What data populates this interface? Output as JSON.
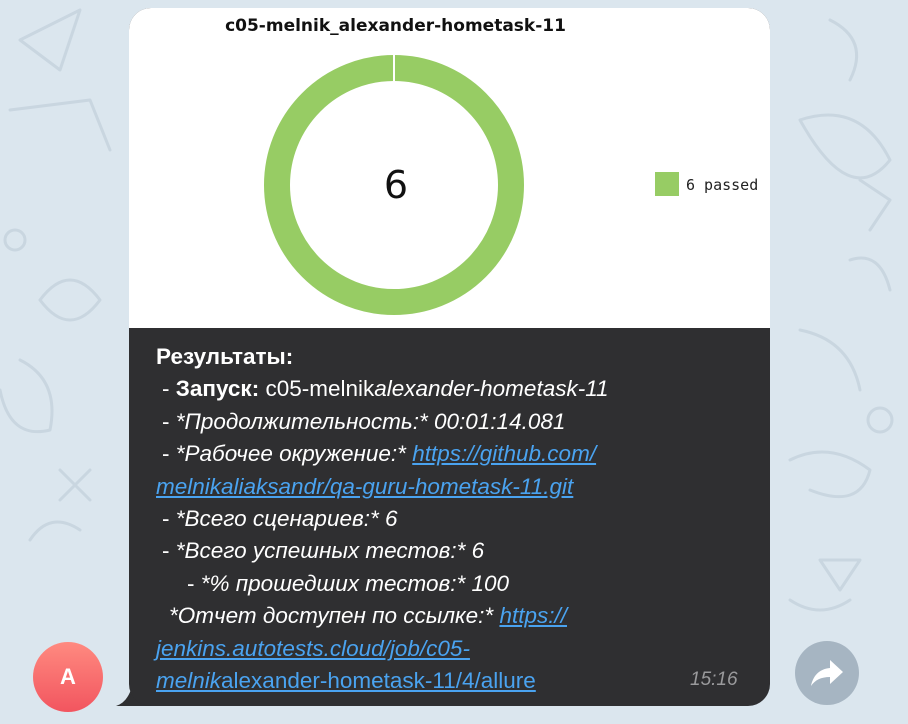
{
  "avatar": {
    "initial": "A",
    "color": "#f2555f"
  },
  "chart": {
    "title": "c05-melnik_alexander-hometask-11",
    "center_value": "6",
    "legend_label": "6 passed",
    "colors": {
      "passed": "#97cc64"
    }
  },
  "chart_data": {
    "type": "pie",
    "donut": true,
    "title": "c05-melnik_alexander-hometask-11",
    "categories": [
      "passed"
    ],
    "values": [
      6
    ],
    "legend": [
      "6 passed"
    ],
    "legend_position": "right"
  },
  "message": {
    "heading": "Результаты:",
    "run_label": "Запуск:",
    "run_value_a": "c05-melnik",
    "run_value_b": "alexander-hometask-11",
    "duration_text": "*Продолжительность:* 00:01:14.081",
    "env_text": "*Рабочее окружение:*",
    "env_link_1": "https://github.com/",
    "env_link_2": "melnikaliaksandr/qa-guru-hometask-11.git",
    "scenarios_text": "*Всего сценариев:* 6",
    "passed_tests_text": "*Всего успешных тестов:* 6",
    "percent_text": "*% прошедших тестов:* 100",
    "report_text": "*Отчет доступен по ссылке:*",
    "report_link_1": "https://",
    "report_link_2": "jenkins.autotests.cloud/job/c05-",
    "report_link_3a": "melnik",
    "report_link_3b": "alexander-hometask-11/4/allure",
    "dash": "-",
    "time": "15:16"
  },
  "share_icon": "share-arrow-icon"
}
